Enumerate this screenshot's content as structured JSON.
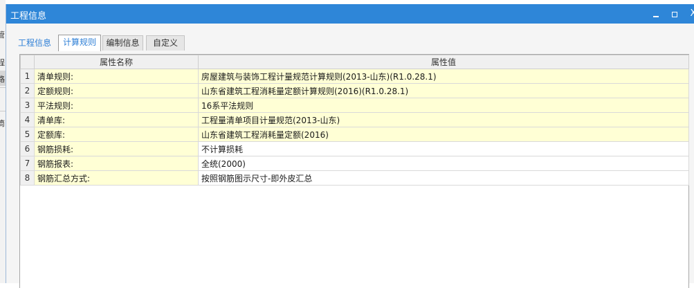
{
  "window": {
    "title": "工程信息"
  },
  "controls": {
    "close": "X"
  },
  "background_app": {
    "glyphs": [
      "管",
      "程",
      "路",
      "筒"
    ]
  },
  "tabs": [
    {
      "label": "工程信息"
    },
    {
      "label": "计算规则"
    },
    {
      "label": "编制信息"
    },
    {
      "label": "自定义"
    }
  ],
  "grid": {
    "headers": {
      "index": "",
      "name": "属性名称",
      "value": "属性值"
    },
    "rows": [
      {
        "index": "1",
        "name": "清单规则:",
        "value": "房屋建筑与装饰工程计量规范计算规则(2013-山东)(R1.0.28.1)"
      },
      {
        "index": "2",
        "name": "定额规则:",
        "value": "山东省建筑工程消耗量定额计算规则(2016)(R1.0.28.1)"
      },
      {
        "index": "3",
        "name": "平法规则:",
        "value": "16系平法规则"
      },
      {
        "index": "4",
        "name": "清单库:",
        "value": "工程量清单项目计量规范(2013-山东)"
      },
      {
        "index": "5",
        "name": "定额库:",
        "value": "山东省建筑工程消耗量定额(2016)"
      },
      {
        "index": "6",
        "name": "钢筋损耗:",
        "value": "不计算损耗"
      },
      {
        "index": "7",
        "name": "钢筋报表:",
        "value": "全统(2000)"
      },
      {
        "index": "8",
        "name": "钢筋汇总方式:",
        "value": "按照钢筋图示尺寸-即外皮汇总"
      }
    ]
  },
  "colors": {
    "titlebar": "#2e86d8",
    "readonly_cell": "#ffffd5",
    "tab_active_text": "#2e7fd6"
  }
}
